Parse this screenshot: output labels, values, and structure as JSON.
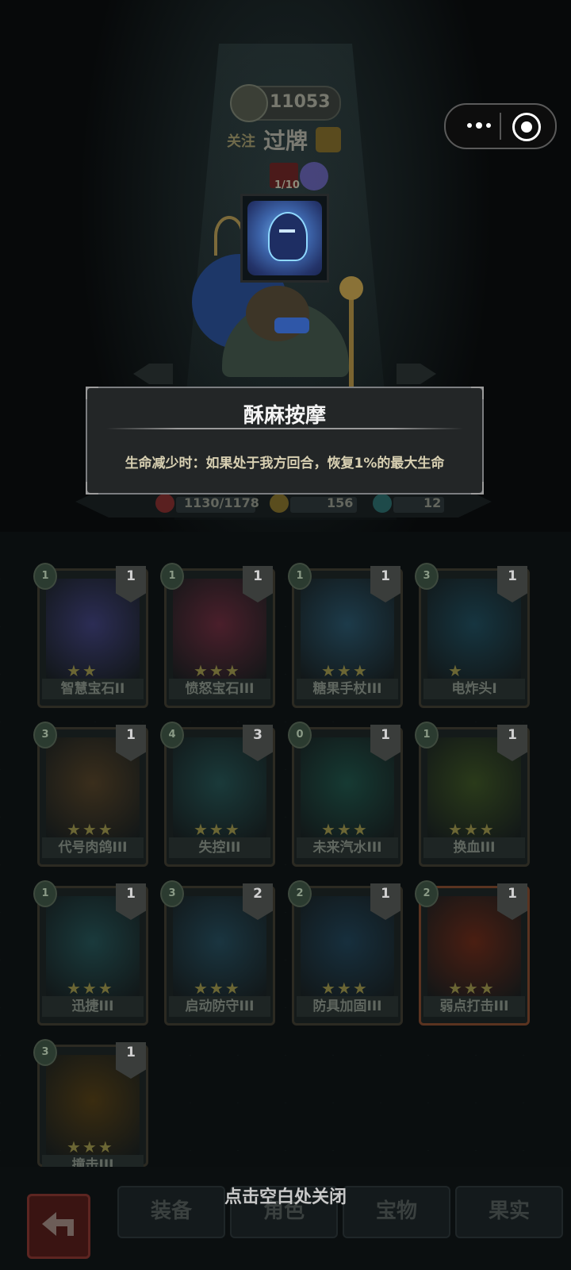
{
  "header": {
    "score": "11053",
    "follow_label": "关注",
    "player_name": "过牌",
    "counter": "1/10"
  },
  "tooltip": {
    "title": "酥麻按摩",
    "description": "生命减少时：如果处于我方回合，恢复1%的最大生命"
  },
  "stats": {
    "hp": "1130/1178",
    "attack": "156",
    "shield": "12"
  },
  "cards": [
    {
      "name": "智慧宝石II",
      "cost": "1",
      "count": "1",
      "stars": "★★",
      "color": "#2c2d55"
    },
    {
      "name": "愤怒宝石III",
      "cost": "1",
      "count": "1",
      "stars": "★★★",
      "color": "#4a1f2b"
    },
    {
      "name": "糖果手杖III",
      "cost": "1",
      "count": "1",
      "stars": "★★★",
      "color": "#1d3b4a"
    },
    {
      "name": "电炸头I",
      "cost": "3",
      "count": "1",
      "stars": "★",
      "color": "#163540"
    },
    {
      "name": "代号肉鸽III",
      "cost": "3",
      "count": "1",
      "stars": "★★★",
      "color": "#3a2e1c"
    },
    {
      "name": "失控III",
      "cost": "4",
      "count": "3",
      "stars": "★★★",
      "color": "#1a3a3a"
    },
    {
      "name": "未来汽水III",
      "cost": "0",
      "count": "1",
      "stars": "★★★",
      "color": "#163a33"
    },
    {
      "name": "换血III",
      "cost": "1",
      "count": "1",
      "stars": "★★★",
      "color": "#2a3a1a"
    },
    {
      "name": "迅捷III",
      "cost": "1",
      "count": "1",
      "stars": "★★★",
      "color": "#1a3a3c"
    },
    {
      "name": "启动防守III",
      "cost": "3",
      "count": "2",
      "stars": "★★★",
      "color": "#1a3540"
    },
    {
      "name": "防具加固III",
      "cost": "2",
      "count": "1",
      "stars": "★★★",
      "color": "#172f3d"
    },
    {
      "name": "弱点打击III",
      "cost": "2",
      "count": "1",
      "stars": "★★★",
      "color": "#4a1e12"
    },
    {
      "name": "撞击III",
      "cost": "3",
      "count": "1",
      "stars": "★★★",
      "color": "#3a2c10"
    }
  ],
  "tabs": [
    "装备",
    "角色",
    "宝物",
    "果实"
  ],
  "close_hint": "点击空白处关闭",
  "colors": {
    "tooltip_bg": "#232627",
    "tooltip_border": "#7b7d80",
    "desc_text": "#d8d0b2"
  }
}
